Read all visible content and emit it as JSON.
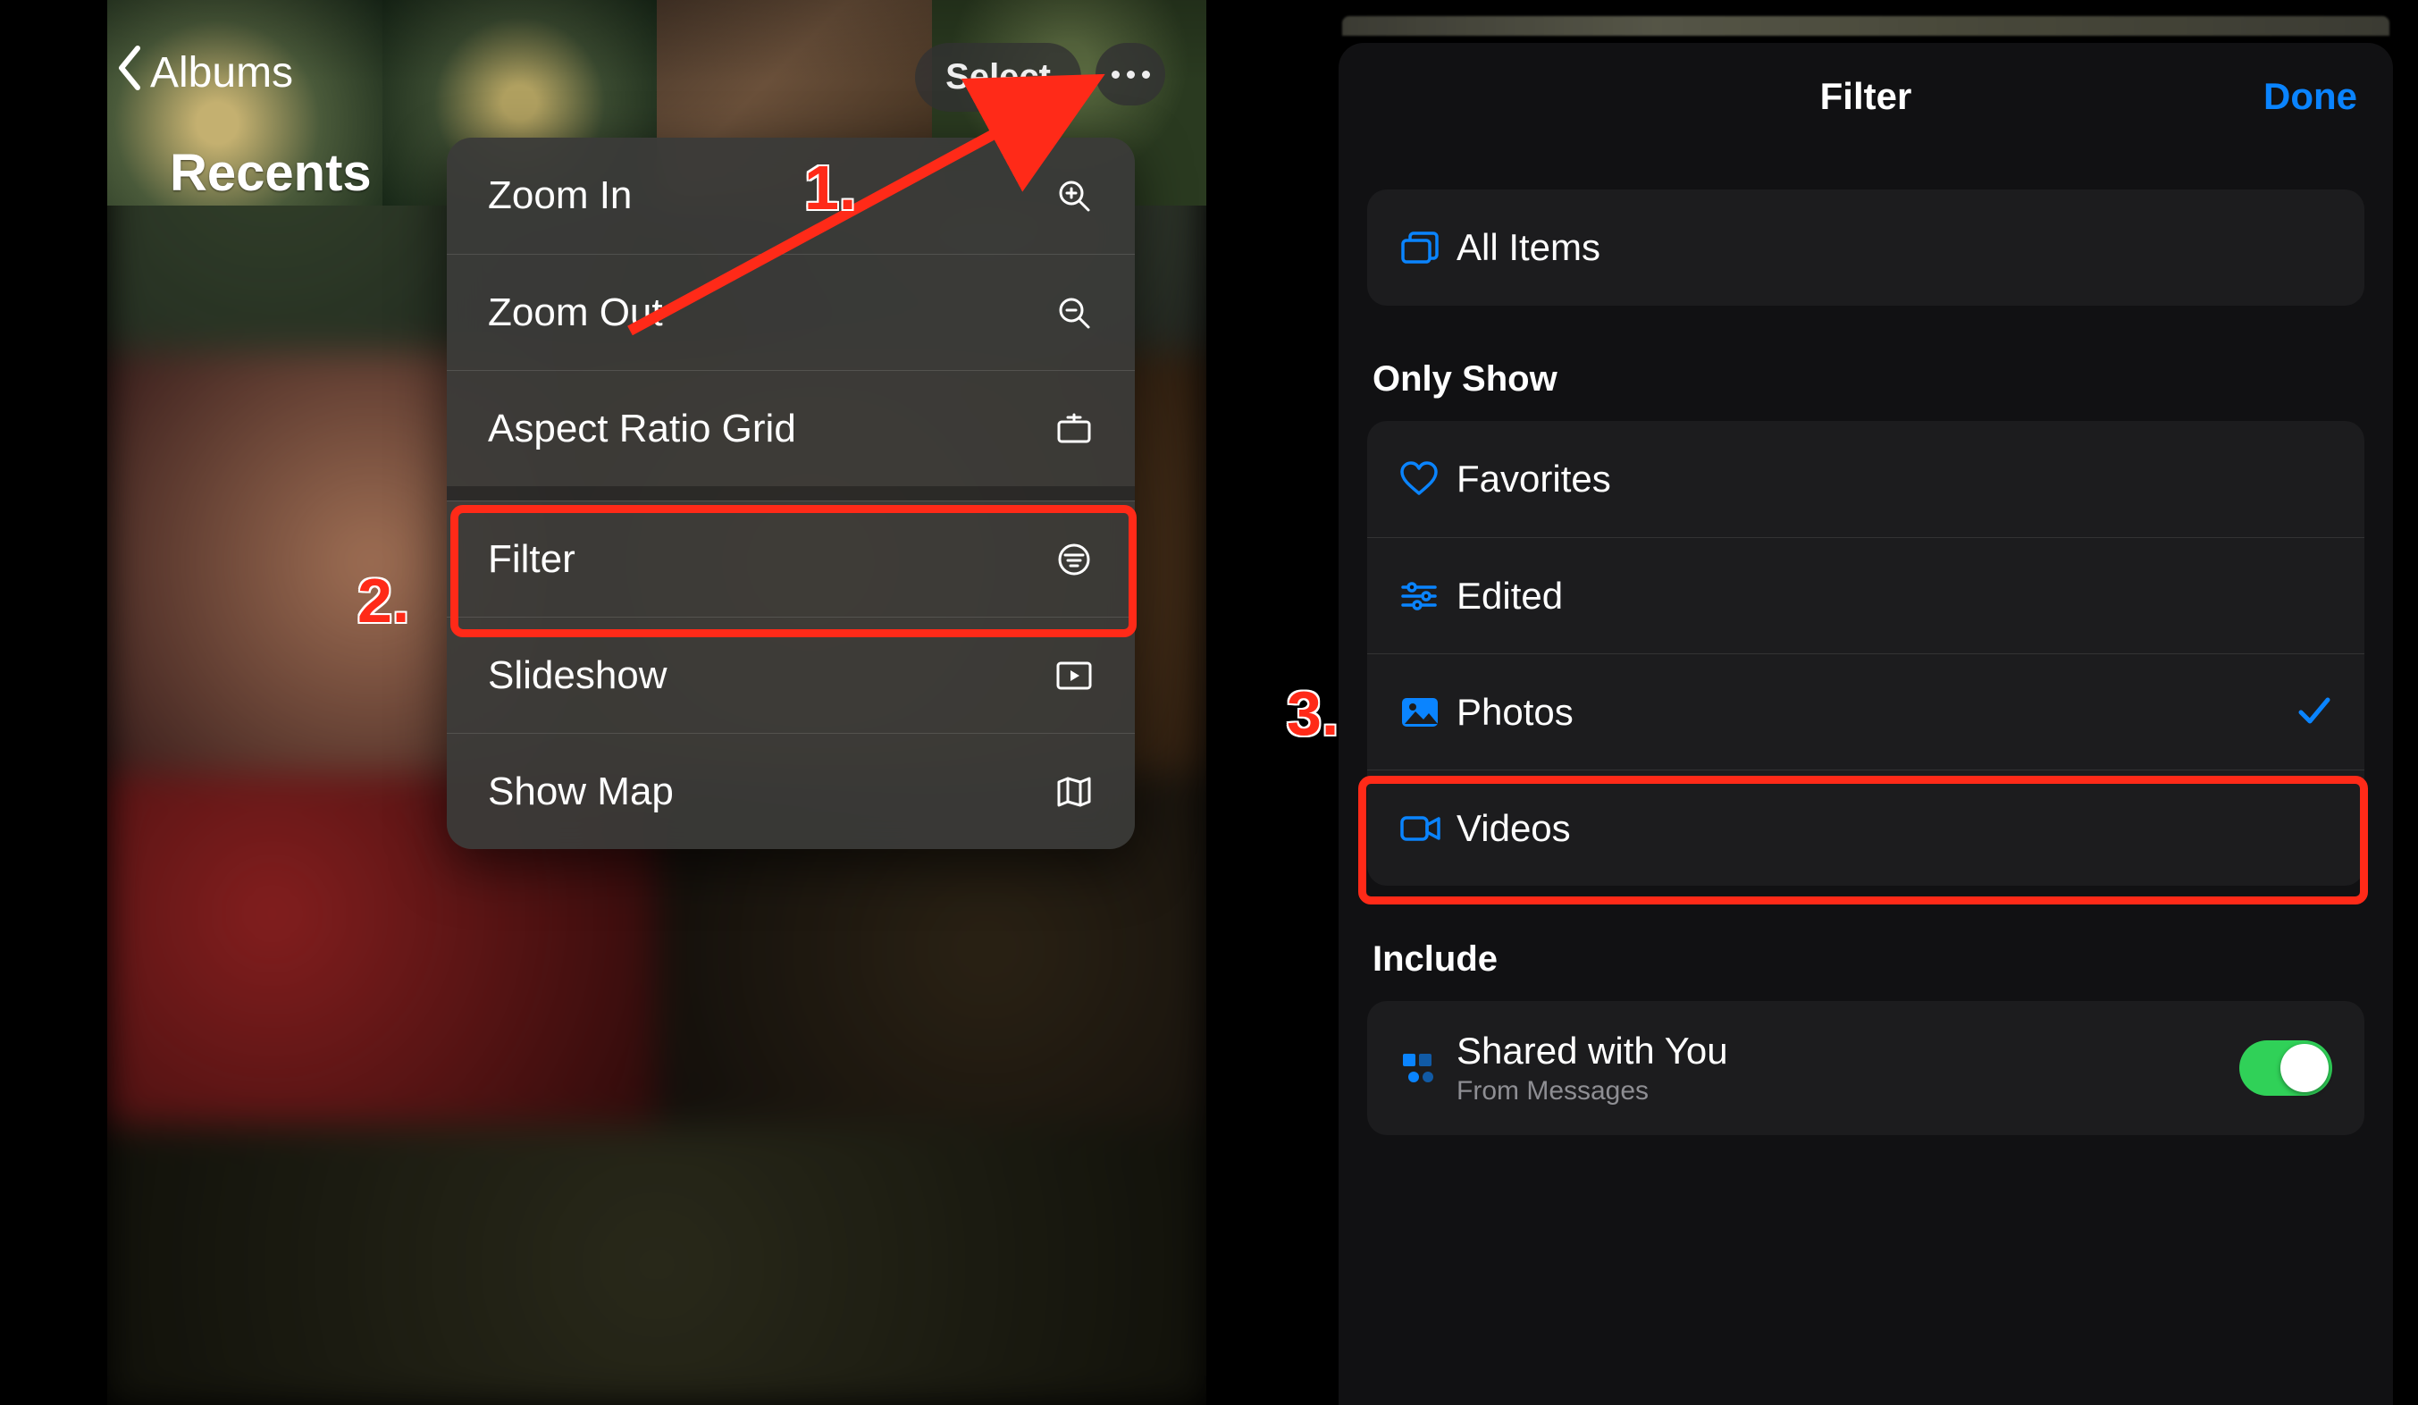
{
  "left": {
    "back_label": "Albums",
    "page_title": "Recents",
    "select_label": "Select",
    "menu": {
      "zoom_in": "Zoom In",
      "zoom_out": "Zoom Out",
      "aspect_ratio": "Aspect Ratio Grid",
      "filter": "Filter",
      "slideshow": "Slideshow",
      "show_map": "Show Map"
    },
    "annotations": {
      "num1": "1.",
      "num2": "2."
    }
  },
  "right": {
    "sheet_title": "Filter",
    "done_label": "Done",
    "all_items": "All Items",
    "section_only_show": "Only Show",
    "favorites": "Favorites",
    "edited": "Edited",
    "photos": "Photos",
    "videos": "Videos",
    "section_include": "Include",
    "shared_with_you": "Shared with You",
    "shared_sub": "From Messages",
    "annotations": {
      "num3": "3."
    }
  }
}
